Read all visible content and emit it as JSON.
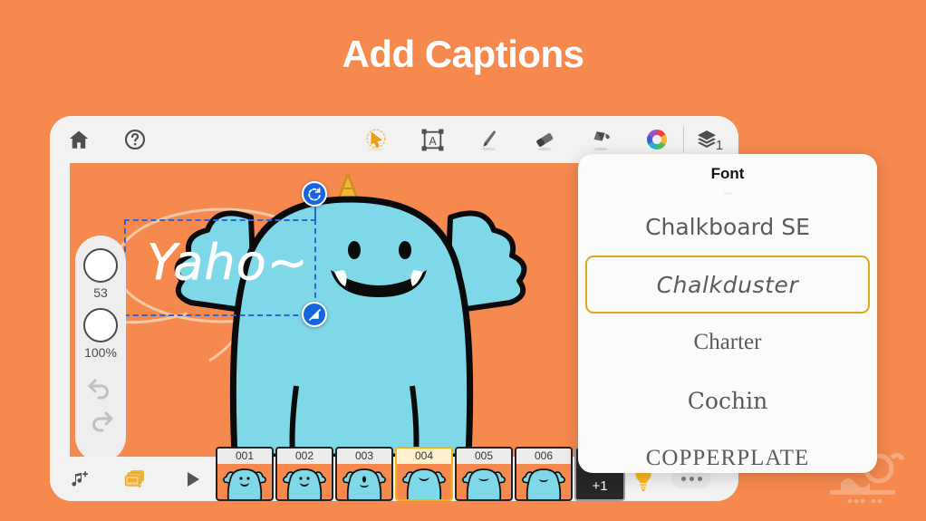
{
  "headline": "Add Captions",
  "toolbar": {
    "home_icon": "home-icon",
    "help_icon": "question-mark-icon",
    "magic_select_icon": "magic-select-cursor-icon",
    "textbox_icon": "text-box-icon",
    "pen_icon": "pen-icon",
    "eraser_icon": "eraser-icon",
    "fill_icon": "paint-bucket-icon",
    "color_icon": "color-wheel-icon",
    "layers_icon": "layers-icon",
    "layers_count": "1"
  },
  "rail": {
    "brush_size": "53",
    "opacity": "100%",
    "undo_icon": "undo-arrow-icon",
    "redo_icon": "redo-arrow-icon"
  },
  "canvas": {
    "caption_text": "Yaho~",
    "rotate_handle_icon": "rotate-handle-icon",
    "resize_handle_icon": "resize-handle-icon",
    "character_name": "blue-monster-character"
  },
  "timeline": {
    "add_audio_icon": "music-note-plus-icon",
    "frames_icon": "frames-stack-icon",
    "play_icon": "play-triangle-icon",
    "bulb_icon": "lightbulb-icon",
    "more_label": "more-options",
    "add_frame_label": "+1",
    "frames": [
      {
        "number": "001",
        "selected": false
      },
      {
        "number": "002",
        "selected": false
      },
      {
        "number": "003",
        "selected": false
      },
      {
        "number": "004",
        "selected": true
      },
      {
        "number": "005",
        "selected": false
      },
      {
        "number": "006",
        "selected": false
      }
    ]
  },
  "font_panel": {
    "title": "Font",
    "items": [
      {
        "label": "Chalkboard SE",
        "selected": false,
        "style": "f-chalkboardse"
      },
      {
        "label": "Chalkduster",
        "selected": true,
        "style": "f-chalkduster"
      },
      {
        "label": "Charter",
        "selected": false,
        "style": "f-charter"
      },
      {
        "label": "Cochin",
        "selected": false,
        "style": "f-cochin"
      },
      {
        "label": "COPPERPLATE",
        "selected": false,
        "style": "f-copperplate"
      }
    ]
  },
  "colors": {
    "background_orange": "#f5894e",
    "panel_white": "#fbfbfa",
    "selection_blue": "#2f64d8",
    "selected_gold": "#e2a520",
    "character_blue": "#7fd8e8",
    "horn_yellow": "#f2b733"
  }
}
